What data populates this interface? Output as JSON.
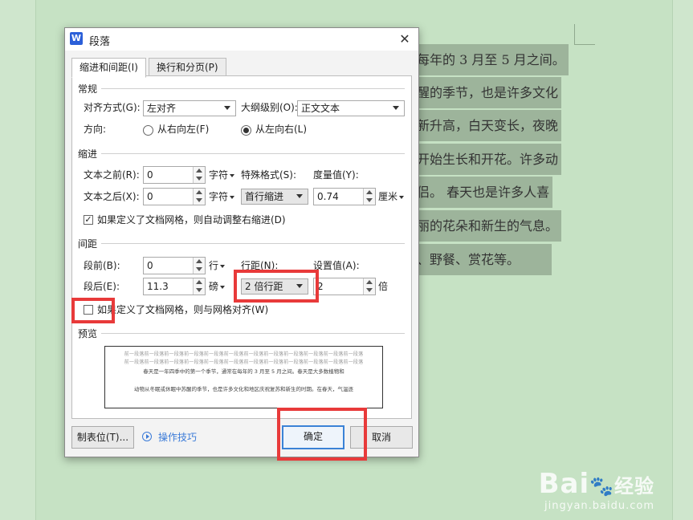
{
  "document": {
    "lines": [
      "每年的 3 月至 5 月之间。",
      "醒的季节，也是许多文化",
      "新升高，白天变长，夜晚",
      "开始生长和开花。许多动",
      "侣。 春天也是许多人喜",
      "丽的花朵和新生的气息。",
      "、野餐、赏花等。"
    ]
  },
  "watermark": {
    "brand_latin": "Bai",
    "brand_cn": "经验",
    "url": "jingyan.baidu.com"
  },
  "dialog": {
    "app_icon_letter": "W",
    "title": "段落",
    "close_glyph": "✕",
    "tabs": [
      {
        "label": "缩进和间距(I)",
        "active": true
      },
      {
        "label": "换行和分页(P)",
        "active": false
      }
    ],
    "general": {
      "section": "常规",
      "alignment_label": "对齐方式(G):",
      "alignment_value": "左对齐",
      "outline_label": "大纲级别(O):",
      "outline_value": "正文文本",
      "direction_label": "方向:",
      "rtl_label": "从右向左(F)",
      "ltr_label": "从左向右(L)",
      "ltr_selected": true
    },
    "indent": {
      "section": "缩进",
      "before_label": "文本之前(R):",
      "before_value": "0",
      "before_unit": "字符",
      "after_label": "文本之后(X):",
      "after_value": "0",
      "after_unit": "字符",
      "special_label": "特殊格式(S):",
      "special_value": "首行缩进",
      "measure_label": "度量值(Y):",
      "measure_value": "0.74",
      "measure_unit": "厘米",
      "auto_adjust_label": "如果定义了文档网格，则自动调整右缩进(D)",
      "auto_adjust_checked": true
    },
    "spacing": {
      "section": "间距",
      "before_label": "段前(B):",
      "before_value": "0",
      "before_unit": "行",
      "after_label": "段后(E):",
      "after_value": "11.3",
      "after_unit": "磅",
      "line_label": "行距(N):",
      "line_value": "2 倍行距",
      "setting_label": "设置值(A):",
      "setting_value": "2",
      "setting_unit": "倍",
      "snap_label": "如果定义了文档网格，则与网格对齐(W)",
      "snap_checked": false
    },
    "preview": {
      "section": "预览",
      "gray_line": "前一段落前一段落前一段落前一段落前一段落前一段落前一段落前一段落前一段落前一段落前一段落前一段落",
      "sample_line1": "春天是一年四季中的第一个季节，通常在每年的 3 月至 5 月之间。春天是大多数植物和",
      "sample_line2": "动物从冬眠或休眠中苏醒的季节，也是许多文化和地区庆祝复苏和新生的时期。在春天，气温逐"
    },
    "buttons": {
      "tabs_label": "制表位(T)...",
      "tips_label": "操作技巧",
      "ok_label": "确定",
      "cancel_label": "取消"
    }
  },
  "colors": {
    "highlight": "#e83a3a",
    "accent": "#3b82d6",
    "doc_background": "#c6e2c4"
  }
}
